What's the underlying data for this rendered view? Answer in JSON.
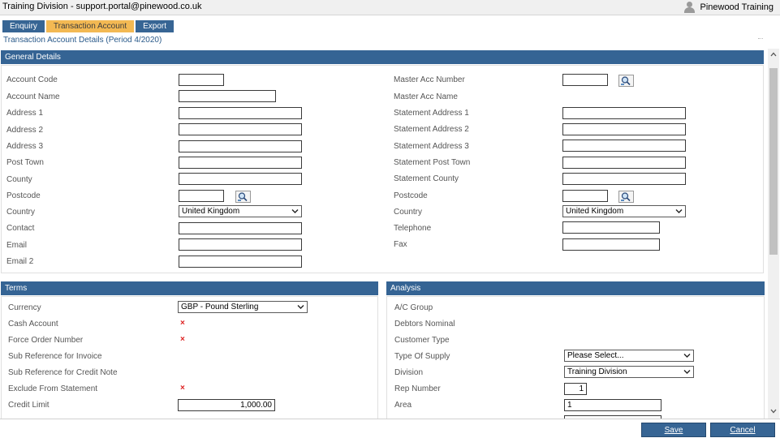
{
  "titlebar": {
    "title": "Training Division - support.portal@pinewood.co.uk",
    "user": "Pinewood Training"
  },
  "tabs": [
    {
      "label": "Enquiry",
      "active": false
    },
    {
      "label": "Transaction Account",
      "active": true
    },
    {
      "label": "Export",
      "active": false
    }
  ],
  "subtitle": "Transaction Account Details (Period 4/2020)",
  "general": {
    "header": "General Details",
    "left": {
      "account_code": {
        "label": "Account Code",
        "value": ""
      },
      "account_name": {
        "label": "Account Name",
        "value": ""
      },
      "address1": {
        "label": "Address 1",
        "value": ""
      },
      "address2": {
        "label": "Address 2",
        "value": ""
      },
      "address3": {
        "label": "Address 3",
        "value": ""
      },
      "post_town": {
        "label": "Post Town",
        "value": ""
      },
      "county": {
        "label": "County",
        "value": ""
      },
      "postcode": {
        "label": "Postcode",
        "value": ""
      },
      "country": {
        "label": "Country",
        "value": "United Kingdom"
      },
      "contact": {
        "label": "Contact",
        "value": ""
      },
      "email": {
        "label": "Email",
        "value": ""
      },
      "email2": {
        "label": "Email 2",
        "value": ""
      }
    },
    "right": {
      "master_acc_number": {
        "label": "Master Acc Number",
        "value": ""
      },
      "master_acc_name": {
        "label": "Master Acc Name"
      },
      "stmt_address1": {
        "label": "Statement Address 1",
        "value": ""
      },
      "stmt_address2": {
        "label": "Statement Address 2",
        "value": ""
      },
      "stmt_address3": {
        "label": "Statement Address 3",
        "value": ""
      },
      "stmt_post_town": {
        "label": "Statement Post Town",
        "value": ""
      },
      "stmt_county": {
        "label": "Statement County",
        "value": ""
      },
      "postcode": {
        "label": "Postcode",
        "value": ""
      },
      "country": {
        "label": "Country",
        "value": "United Kingdom"
      },
      "telephone": {
        "label": "Telephone",
        "value": ""
      },
      "fax": {
        "label": "Fax",
        "value": ""
      }
    }
  },
  "terms": {
    "header": "Terms",
    "currency": {
      "label": "Currency",
      "value": "GBP - Pound Sterling"
    },
    "cash_account": {
      "label": "Cash Account",
      "mark": "×"
    },
    "force_order_number": {
      "label": "Force Order Number",
      "mark": "×"
    },
    "sub_ref_invoice": {
      "label": "Sub Reference for Invoice"
    },
    "sub_ref_credit": {
      "label": "Sub Reference for Credit Note"
    },
    "exclude_statement": {
      "label": "Exclude From Statement",
      "mark": "×"
    },
    "credit_limit": {
      "label": "Credit Limit",
      "value": "1,000.00"
    }
  },
  "analysis": {
    "header": "Analysis",
    "ac_group": {
      "label": "A/C Group"
    },
    "debtors_nominal": {
      "label": "Debtors Nominal"
    },
    "customer_type": {
      "label": "Customer Type"
    },
    "type_of_supply": {
      "label": "Type Of Supply",
      "value": "Please Select..."
    },
    "division": {
      "label": "Division",
      "value": "Training Division"
    },
    "rep_number": {
      "label": "Rep Number",
      "value": "1"
    },
    "area": {
      "label": "Area",
      "value": "1"
    }
  },
  "footer": {
    "save": "Save",
    "cancel": "Cancel"
  },
  "colors": {
    "header": "#356494",
    "active_tab": "#f3b953",
    "error_mark": "#dd2222"
  },
  "icons": {
    "lookup": "magnifier-lookup-icon",
    "user": "user-icon",
    "dropdown": "chevron-down-icon"
  }
}
